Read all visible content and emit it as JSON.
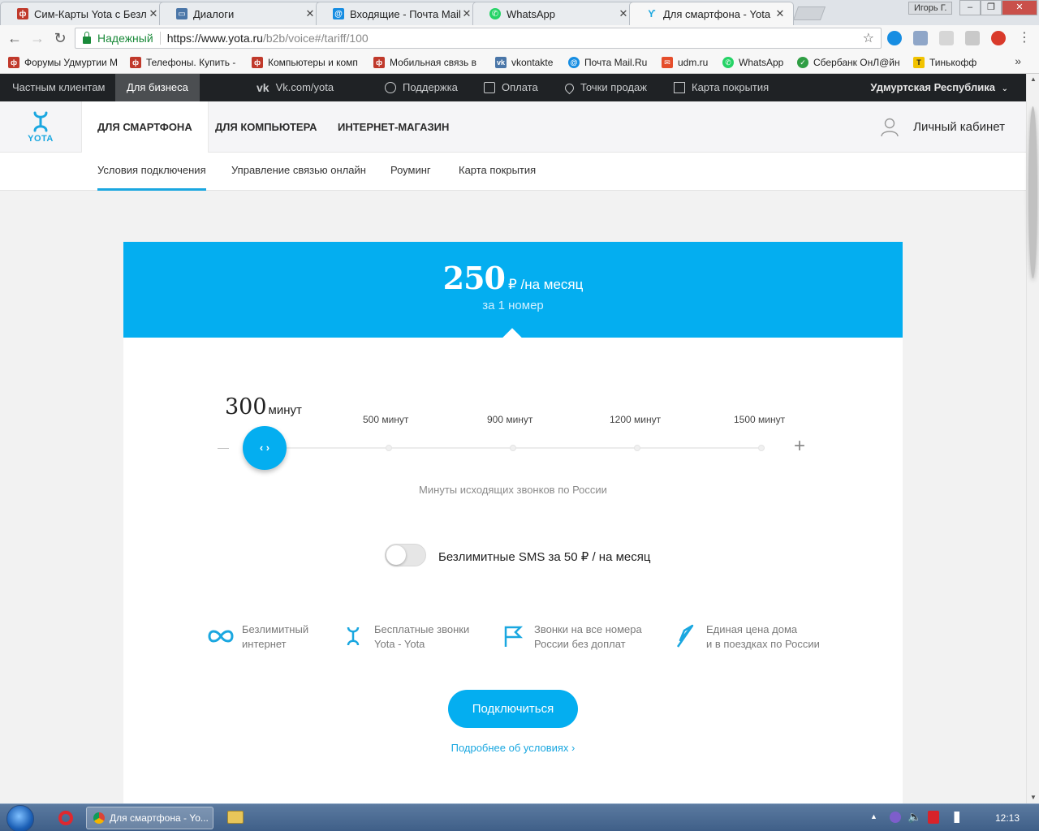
{
  "browser": {
    "tabs": [
      {
        "title": "Сим-Карты Yota с Безл",
        "favicon": "forum-icon",
        "color": "#c0392b"
      },
      {
        "title": "Диалоги",
        "favicon": "vk-icon",
        "color": "#4a76a8"
      },
      {
        "title": "Входящие - Почта Mail.",
        "favicon": "mail-ru-icon",
        "color": "#168de2"
      },
      {
        "title": "WhatsApp",
        "favicon": "whatsapp-icon",
        "color": "#25d366"
      },
      {
        "title": "Для смартфона - Yota",
        "favicon": "yota-icon",
        "color": "#1aa7e0"
      }
    ],
    "user": "Игорь Г.",
    "secure_label": "Надежный",
    "url_host": "https://www.yota.ru",
    "url_path": "/b2b/voice#/tariff/100",
    "bookmarks": [
      "Форумы Удмуртии М",
      "Телефоны. Купить -",
      "Компьютеры и комп",
      "Мобильная связь в",
      "vkontakte",
      "Почта Mail.Ru",
      "udm.ru",
      "WhatsApp",
      "Сбербанк ОнЛ@йн",
      "Тинькофф"
    ]
  },
  "topbar": {
    "private": "Частным клиентам",
    "business": "Для бизнеса",
    "vk": "Vk.com/yota",
    "support": "Поддержка",
    "payment": "Оплата",
    "points": "Точки продаж",
    "coverage": "Карта покрытия",
    "region": "Удмуртская Республика"
  },
  "mainnav": {
    "logo_text": "YOTA",
    "items": [
      "Для смартфона",
      "Для компьютера",
      "Интернет-магазин"
    ],
    "cabinet": "Личный кабинет"
  },
  "subnav": {
    "items": [
      "Условия подключения",
      "Управление связью онлайн",
      "Роуминг",
      "Карта покрытия"
    ]
  },
  "tariff": {
    "price": "250",
    "price_unit": "₽ /на месяц",
    "per_number": "за 1 номер",
    "selected_minutes": "300",
    "selected_unit": "минут",
    "marks": [
      "500 минут",
      "900 минут",
      "1200 минут",
      "1500 минут"
    ],
    "slider_value": 300,
    "slider_description": "Минуты исходящих звонков по России",
    "sms_label": "Безлимитные SMS за 50 ₽ / на месяц",
    "sms_enabled": false,
    "features": [
      {
        "icon": "infinity-icon",
        "text": "Безлимитный\nинтернет"
      },
      {
        "icon": "yota-icon",
        "text": "Бесплатные звонки\nYota - Yota"
      },
      {
        "icon": "flag-icon",
        "text": "Звонки на все номера\nРоссии без доплат"
      },
      {
        "icon": "compass-icon",
        "text": "Единая цена дома\nи в поездках по России"
      }
    ],
    "connect_button": "Подключиться",
    "more_link": "Подробнее об условиях ›"
  },
  "taskbar": {
    "chrome_item": "Для смартфона - Yo...",
    "clock": "12:13"
  },
  "colors": {
    "accent": "#04aef0",
    "topbar_bg": "#1f2225"
  }
}
